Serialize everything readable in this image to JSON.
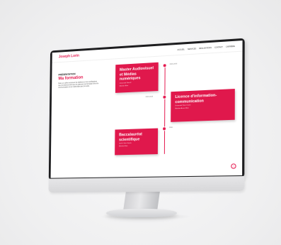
{
  "site": {
    "logo": "Joseph Lorin",
    "nav": [
      "Accueil",
      "Services",
      "Réalisations",
      "Contact",
      "Carrière"
    ]
  },
  "intro": {
    "kicker": "Présentation",
    "title": "Ma formation",
    "text": "Dans un coffret retrouvez les diplômes et les certifications que j'ai obtenus ainsi que les parcours de formation liés à la communication et au multimédia que j'ai suivis."
  },
  "timeline": [
    {
      "date": "2015-2016",
      "title": "Master Audiovisuel et Médias numériques",
      "lines": [
        "Université Paris 8",
        "Mention Bien"
      ]
    },
    {
      "date": "2013-2014",
      "title": "Licence d'information-communication",
      "lines": [
        "Université Paris Ouest",
        "Mention Assez Bien"
      ]
    },
    {
      "date": "2010",
      "title": "Baccalauréat scientifique",
      "lines": [
        "Lycée Jean Jaurès",
        "Mention Bien"
      ]
    }
  ],
  "scroll_icon": "scroll-up-icon",
  "colors": {
    "accent": "#e5194f",
    "card": "#e0184c"
  }
}
